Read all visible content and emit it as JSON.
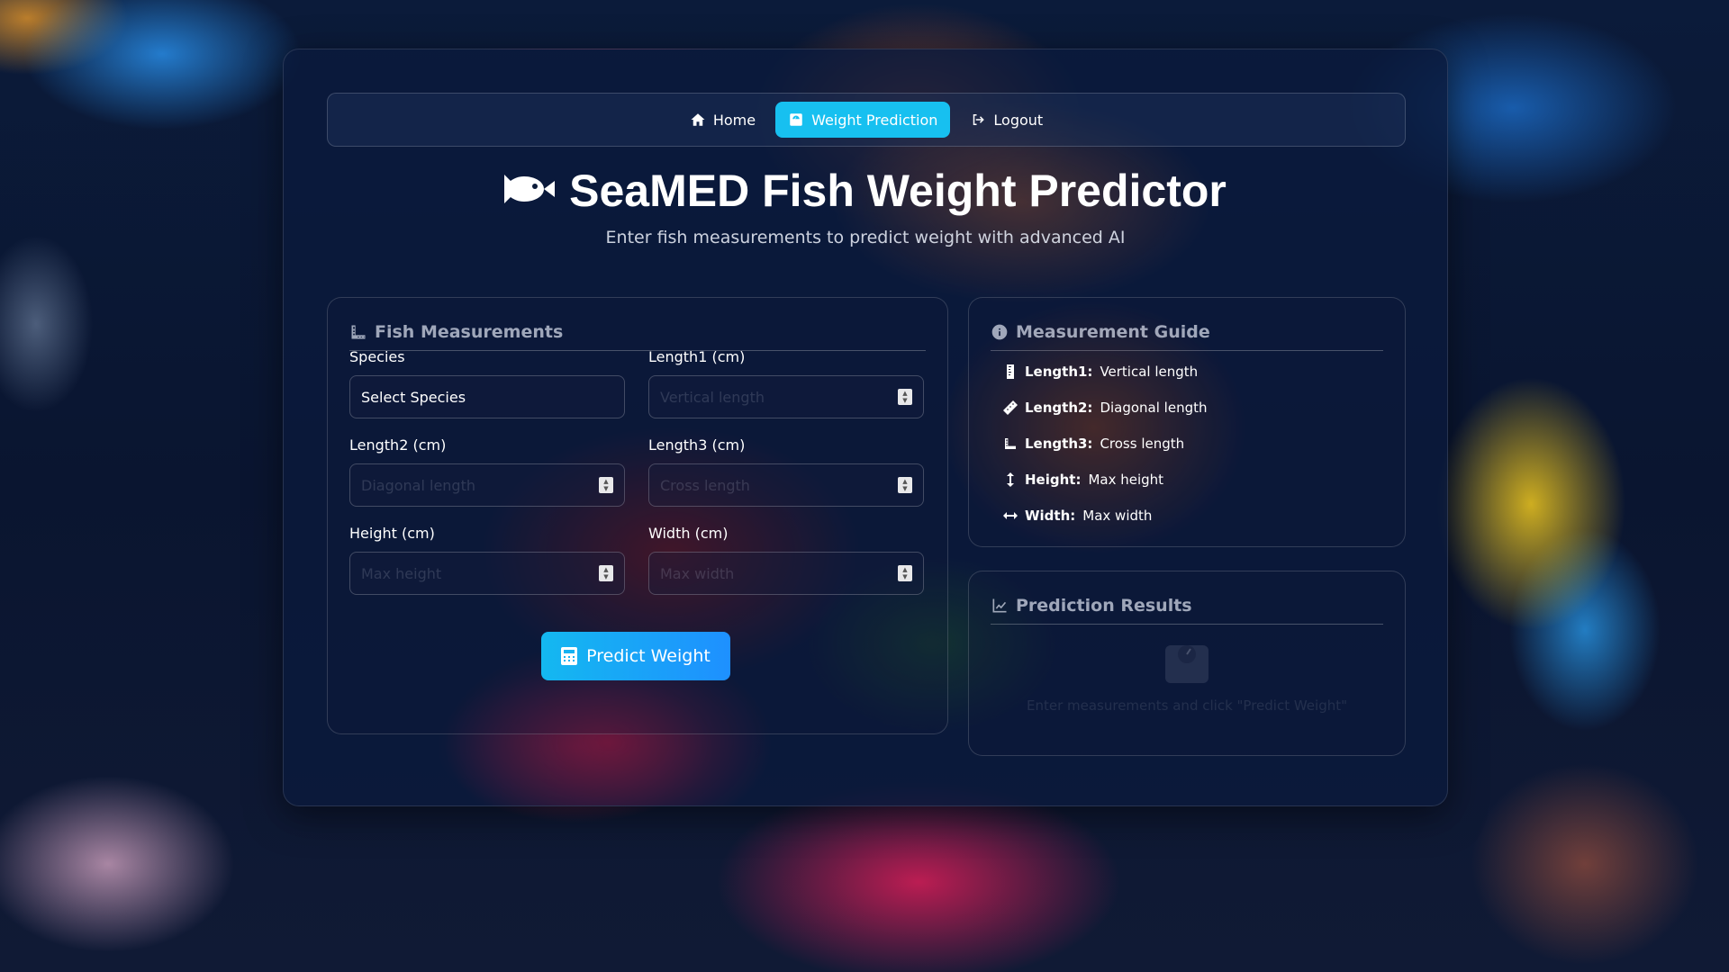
{
  "nav": {
    "items": [
      {
        "label": "Home",
        "icon": "home-icon",
        "active": false
      },
      {
        "label": "Weight Prediction",
        "icon": "scale-icon",
        "active": true
      },
      {
        "label": "Logout",
        "icon": "logout-icon",
        "active": false
      }
    ]
  },
  "header": {
    "title": "SeaMED Fish Weight Predictor",
    "subtitle": "Enter fish measurements to predict weight with advanced AI",
    "icon": "fish-icon"
  },
  "form": {
    "title": "Fish Measurements",
    "species_label": "Species",
    "species_value": "Select Species",
    "length1_label": "Length1 (cm)",
    "length1_placeholder": "Vertical length",
    "length2_label": "Length2 (cm)",
    "length2_placeholder": "Diagonal length",
    "length3_label": "Length3 (cm)",
    "length3_placeholder": "Cross length",
    "height_label": "Height (cm)",
    "height_placeholder": "Max height",
    "width_label": "Width (cm)",
    "width_placeholder": "Max width",
    "predict_label": "Predict Weight"
  },
  "guide": {
    "title": "Measurement Guide",
    "items": [
      {
        "term": "Length1:",
        "desc": "Vertical length",
        "icon": "ruler-vertical-icon"
      },
      {
        "term": "Length2:",
        "desc": "Diagonal length",
        "icon": "ruler-diagonal-icon"
      },
      {
        "term": "Length3:",
        "desc": "Cross length",
        "icon": "ruler-combined-icon"
      },
      {
        "term": "Height:",
        "desc": "Max height",
        "icon": "arrows-vertical-icon"
      },
      {
        "term": "Width:",
        "desc": "Max width",
        "icon": "arrows-horizontal-icon"
      }
    ]
  },
  "results": {
    "title": "Prediction Results",
    "empty_text": "Enter measurements and click \"Predict Weight\""
  },
  "colors": {
    "accent": "#17c0f0",
    "button_gradient_start": "#14b8f0",
    "button_gradient_end": "#1e90ff"
  }
}
